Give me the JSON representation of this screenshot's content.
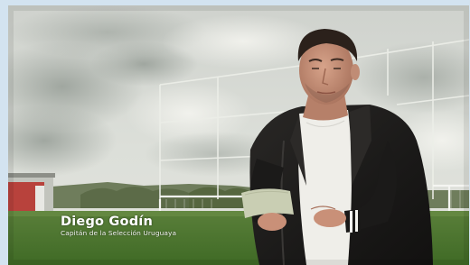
{
  "caption": {
    "name": "Diego Godín",
    "role": "Capitán de la Selección Uruguaya"
  },
  "colors": {
    "sky": "#d9ddd8",
    "grass": "#4e7a2e",
    "jacket": "#1d1c1b",
    "shirt": "#f1f0ec",
    "frame": "#d3e3f0"
  }
}
